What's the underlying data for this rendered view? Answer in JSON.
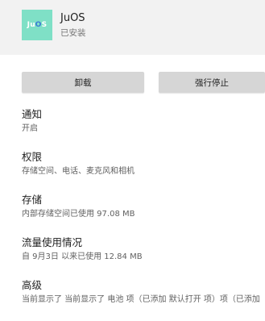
{
  "app": {
    "icon_text_left": "Ju",
    "icon_text_o": "O",
    "icon_text_right": "S",
    "name": "JuOS",
    "status": "已安装"
  },
  "buttons": {
    "uninstall": "卸载",
    "force_stop": "强行停止"
  },
  "settings": {
    "notifications": {
      "title": "通知",
      "summary": "开启"
    },
    "permissions": {
      "title": "权限",
      "summary": "存储空间、电话、麦克风和相机"
    },
    "storage": {
      "title": "存储",
      "summary": "内部存储空间已使用 97.08 MB"
    },
    "data_usage": {
      "title": "流量使用情况",
      "summary": "自 9月3日 以来已使用 12.84 MB"
    },
    "advanced": {
      "title": "高级",
      "summary": "当前显示了 当前显示了 电池 项（已添加 默认打开 项）项（已添加"
    }
  },
  "colors": {
    "header_bg": "#f2f2f2",
    "icon_bg": "#7fe0c6",
    "button_bg": "#d6d6d6"
  }
}
